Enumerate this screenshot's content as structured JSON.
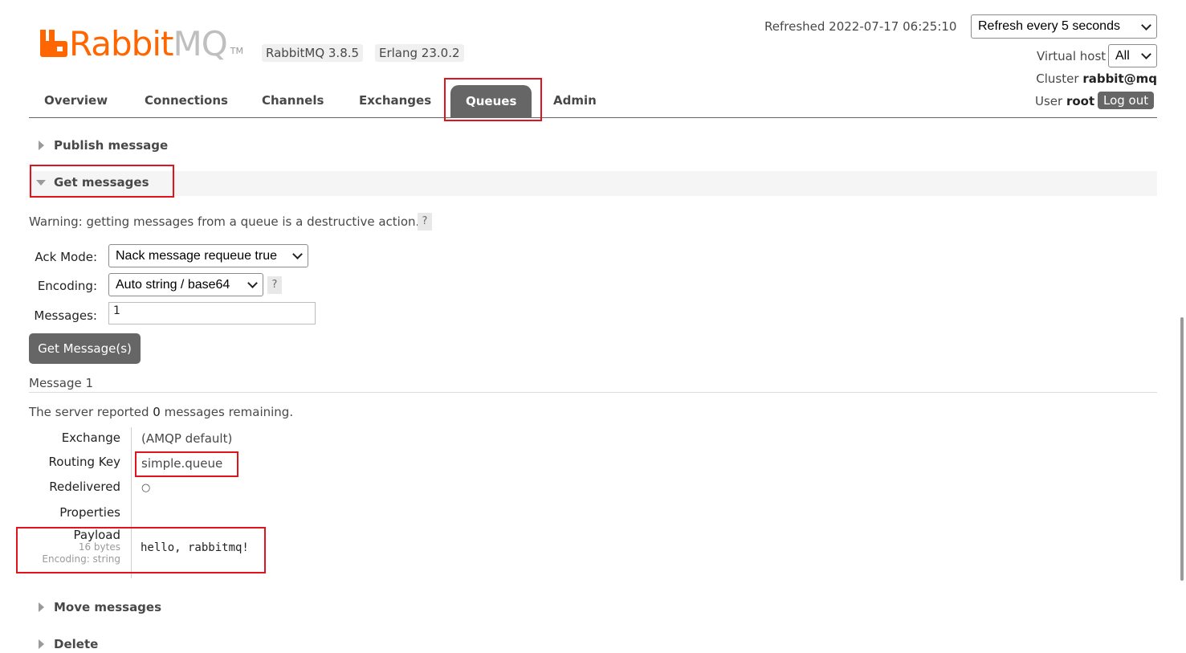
{
  "header": {
    "logo_text_a": "Rabbit",
    "logo_text_b": "MQ",
    "logo_tm": "TM",
    "version_badge": "RabbitMQ 3.8.5",
    "erlang_badge": "Erlang 23.0.2",
    "refreshed_label": "Refreshed 2022-07-17 06:25:10",
    "refresh_select": "Refresh every 5 seconds",
    "vhost_label": "Virtual host",
    "vhost_select": "All",
    "cluster_label": "Cluster",
    "cluster_name": "rabbit@mq",
    "user_label": "User",
    "user_name": "root",
    "logout_label": "Log out"
  },
  "nav": {
    "tabs": [
      "Overview",
      "Connections",
      "Channels",
      "Exchanges",
      "Queues",
      "Admin"
    ],
    "active": "Queues"
  },
  "sections": {
    "publish": "Publish message",
    "get": "Get messages",
    "move": "Move messages",
    "delete": "Delete"
  },
  "get_messages": {
    "warning": "Warning: getting messages from a queue is a destructive action.",
    "help_glyph": "?",
    "ack_label": "Ack Mode:",
    "ack_value": "Nack message requeue true",
    "encoding_label": "Encoding:",
    "encoding_value": "Auto string / base64",
    "messages_label": "Messages:",
    "messages_value": "1",
    "button_label": "Get Message(s)"
  },
  "result": {
    "message_title": "Message 1",
    "server_prefix": "The server reported",
    "remaining_count": "0",
    "server_suffix": "messages remaining.",
    "exchange_label": "Exchange",
    "exchange_value": "(AMQP default)",
    "routing_label": "Routing Key",
    "routing_value": "simple.queue",
    "redelivered_label": "Redelivered",
    "redelivered_value": "○",
    "properties_label": "Properties",
    "payload_label": "Payload",
    "payload_size": "16 bytes",
    "payload_encoding": "Encoding: string",
    "payload_value": "hello, rabbitmq!"
  },
  "colors": {
    "brand_orange": "#ff6600",
    "tab_active_bg": "#666666",
    "highlight_red": "#e1141e"
  }
}
